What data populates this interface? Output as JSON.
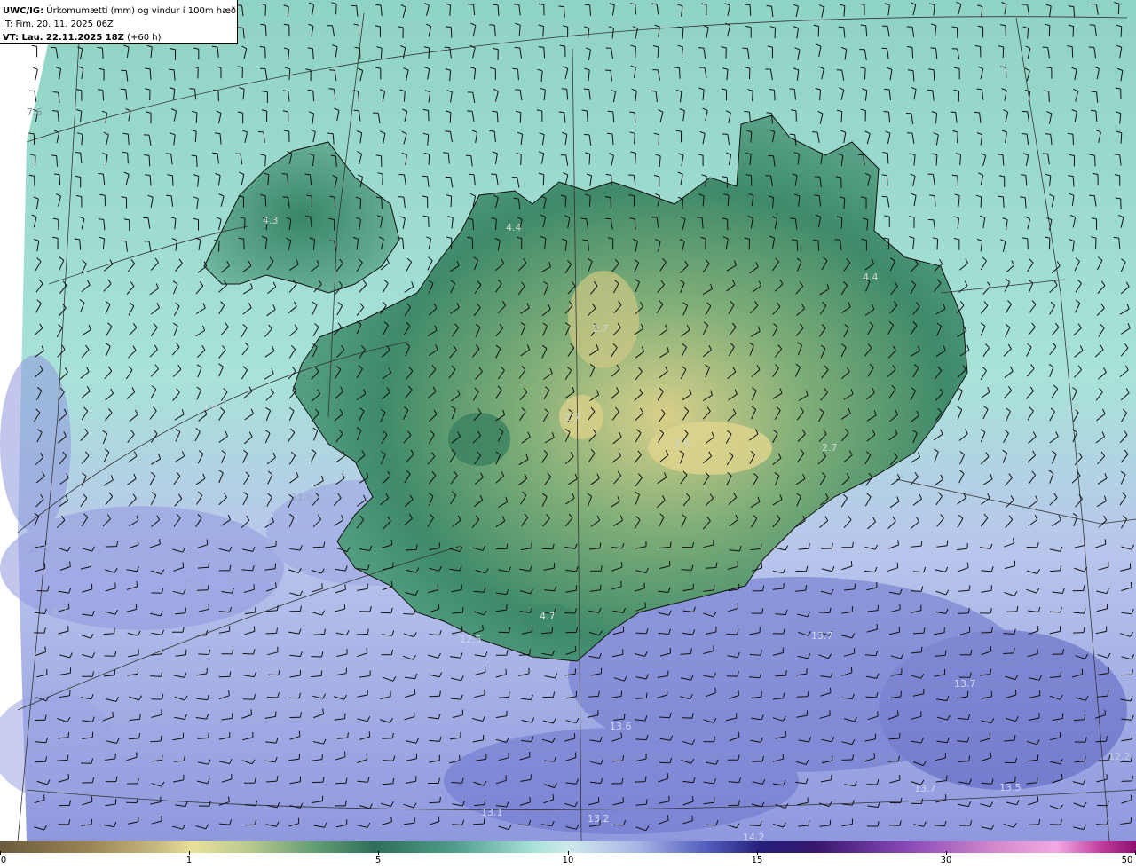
{
  "header": {
    "product_code": "UWC/IG:",
    "title": " Úrkomumætti (mm) og vindur í 100m hæð",
    "init_time": "IT: Fim. 20. 11. 2025 06Z",
    "valid_prefix": "VT: Lau. 22.11.2025 18Z",
    "valid_suffix": " (+60 h)"
  },
  "map_labels": [
    {
      "text": "7.6"
    },
    {
      "text": "4.3"
    },
    {
      "text": "4.4"
    },
    {
      "text": "4.4"
    },
    {
      "text": "2.7"
    },
    {
      "text": "2.7"
    },
    {
      "text": "3.0"
    },
    {
      "text": "2.7"
    },
    {
      "text": "5.0"
    },
    {
      "text": "11.6"
    },
    {
      "text": "12.5"
    },
    {
      "text": "12.1"
    },
    {
      "text": "9.2"
    },
    {
      "text": "4.7"
    },
    {
      "text": "12.5"
    },
    {
      "text": "13.7"
    },
    {
      "text": "13.7"
    },
    {
      "text": "13.6"
    },
    {
      "text": "13.1"
    },
    {
      "text": "13.2"
    },
    {
      "text": "14.2"
    },
    {
      "text": "13.7"
    },
    {
      "text": "13.5"
    },
    {
      "text": "12.2"
    },
    {
      "text": "7.4"
    }
  ],
  "colorbar": {
    "ticks": [
      "0",
      "1",
      "5",
      "10",
      "15",
      "30",
      "50"
    ],
    "tick_colors": [
      "#6b5a3c",
      "#e8e09a",
      "#2f6f58",
      "#cfe9ea",
      "#25207a",
      "#d68ccc",
      "#8e0f70"
    ]
  },
  "colors": {
    "land_high": "#d7cf86",
    "land_mid": "#3f8a6a",
    "sea_light": "#a9e2d8",
    "sea_precip": "#7d86d4",
    "coast": "#111111"
  }
}
